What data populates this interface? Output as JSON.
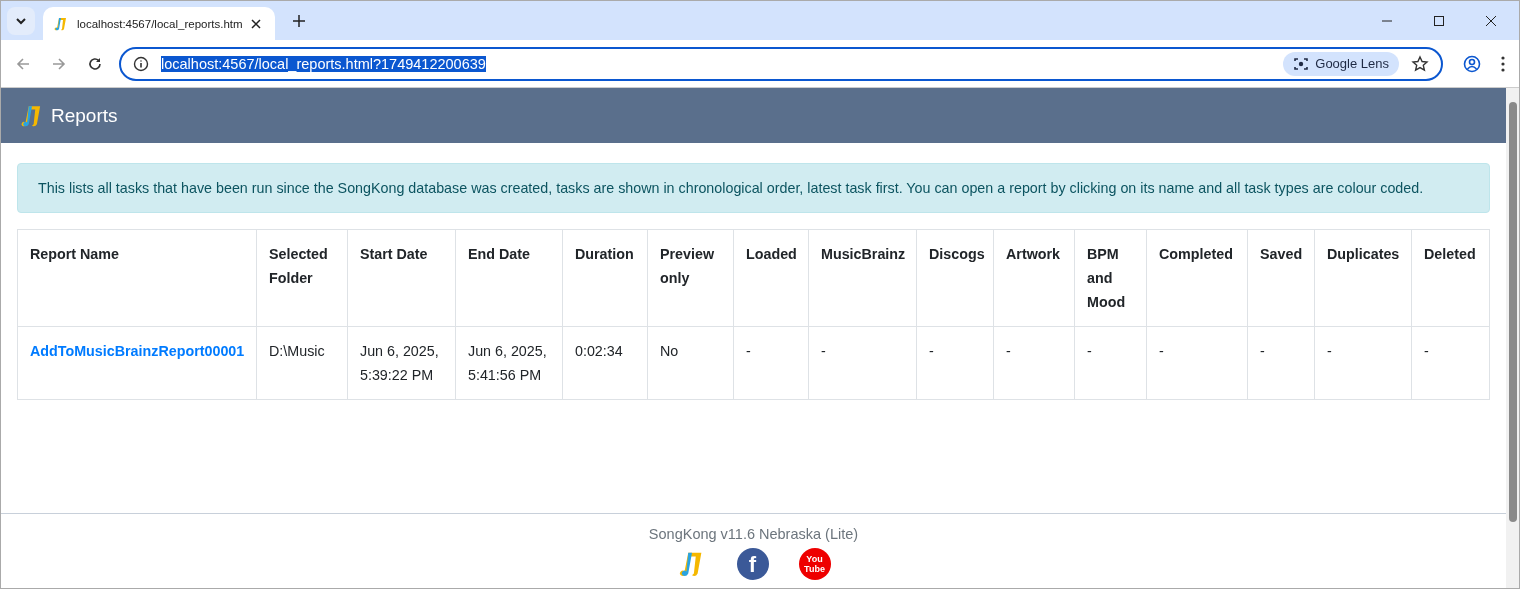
{
  "browser": {
    "tab_title": "localhost:4567/local_reports.htm",
    "url": "localhost:4567/local_reports.html?1749412200639",
    "url_selected": true,
    "lens_label": "Google Lens"
  },
  "header": {
    "title": "Reports"
  },
  "notice": "This lists all tasks that have been run since the SongKong database was created, tasks are shown in chronological order, latest task first. You can open a report by clicking on its name and all task types are colour coded.",
  "table": {
    "columns": [
      "Report Name",
      "Selected Folder",
      "Start Date",
      "End Date",
      "Duration",
      "Preview only",
      "Loaded",
      "MusicBrainz",
      "Discogs",
      "Artwork",
      "BPM and Mood",
      "Completed",
      "Saved",
      "Duplicates",
      "Deleted"
    ],
    "rows": [
      {
        "cells": [
          "AddToMusicBrainzReport00001",
          "D:\\Music",
          "Jun 6, 2025, 5:39:22 PM",
          "Jun 6, 2025, 5:41:56 PM",
          "0:02:34",
          "No",
          "-",
          "-",
          "-",
          "-",
          "-",
          "-",
          "-",
          "-",
          "-"
        ]
      }
    ]
  },
  "footer": {
    "version": "SongKong v11.6 Nebraska (Lite)",
    "facebook_letter": "f",
    "video_logo": [
      "You",
      "Tube"
    ]
  }
}
